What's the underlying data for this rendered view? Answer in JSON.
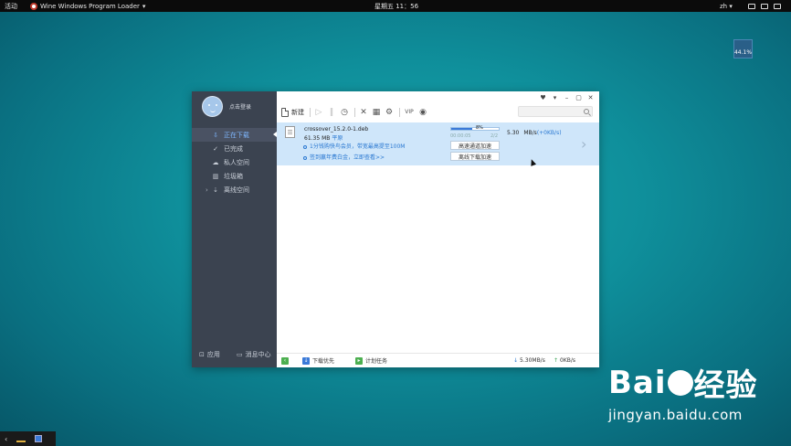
{
  "topbar": {
    "activities": "活动",
    "app_title": "Wine Windows Program Loader",
    "app_arrow": "▾",
    "clock": "星期五 11：56",
    "lang": "zh",
    "lang_arrow": "▾"
  },
  "cpu_widget": {
    "percent": "44.1%"
  },
  "sidebar": {
    "login": "点击登录",
    "items": [
      {
        "icon": "download-icon",
        "label": "正在下载"
      },
      {
        "icon": "check-icon",
        "label": "已完成"
      },
      {
        "icon": "cloud-icon",
        "label": "私人空间"
      },
      {
        "icon": "trash-icon",
        "label": "垃圾箱"
      },
      {
        "icon": "cloud-dl-icon",
        "label": "离线空间"
      }
    ],
    "bottom_apps": "应用",
    "bottom_messages": "消息中心"
  },
  "toolbar": {
    "new_label": "新建",
    "vip": "VIP"
  },
  "window_controls": [
    "♥",
    "▾",
    "–",
    "▢",
    "✕"
  ],
  "download": {
    "filename": "crossover_15.2.0-1.deb",
    "size": "61.35 MB",
    "status": "平原",
    "promo1": "1分钱购快鸟会员，带宽最高提至100M",
    "promo2": "签到赢年费白金，立即查看>>",
    "progress_percent": "8%",
    "progress_fraction": 0.45,
    "elapsed": "00:00:05",
    "count": "2/2",
    "accel_button_1": "高速通道加速",
    "accel_button_2": "离线下载加速",
    "speed": "5.30",
    "speed_unit": "MB/s",
    "speed_extra": "(+0KB/s)"
  },
  "statusbar": {
    "priority": "下载优先",
    "plan": "计划任务",
    "down_speed": "5.30MB/s",
    "up_speed": "0KB/s"
  },
  "watermark": {
    "brand_left": "Bai",
    "brand_right": "经验",
    "url": "jingyan.baidu.com"
  },
  "colors": {
    "accent": "#2a78d1",
    "sidebar": "#3b4350",
    "row_highlight": "#cfe6fa"
  }
}
